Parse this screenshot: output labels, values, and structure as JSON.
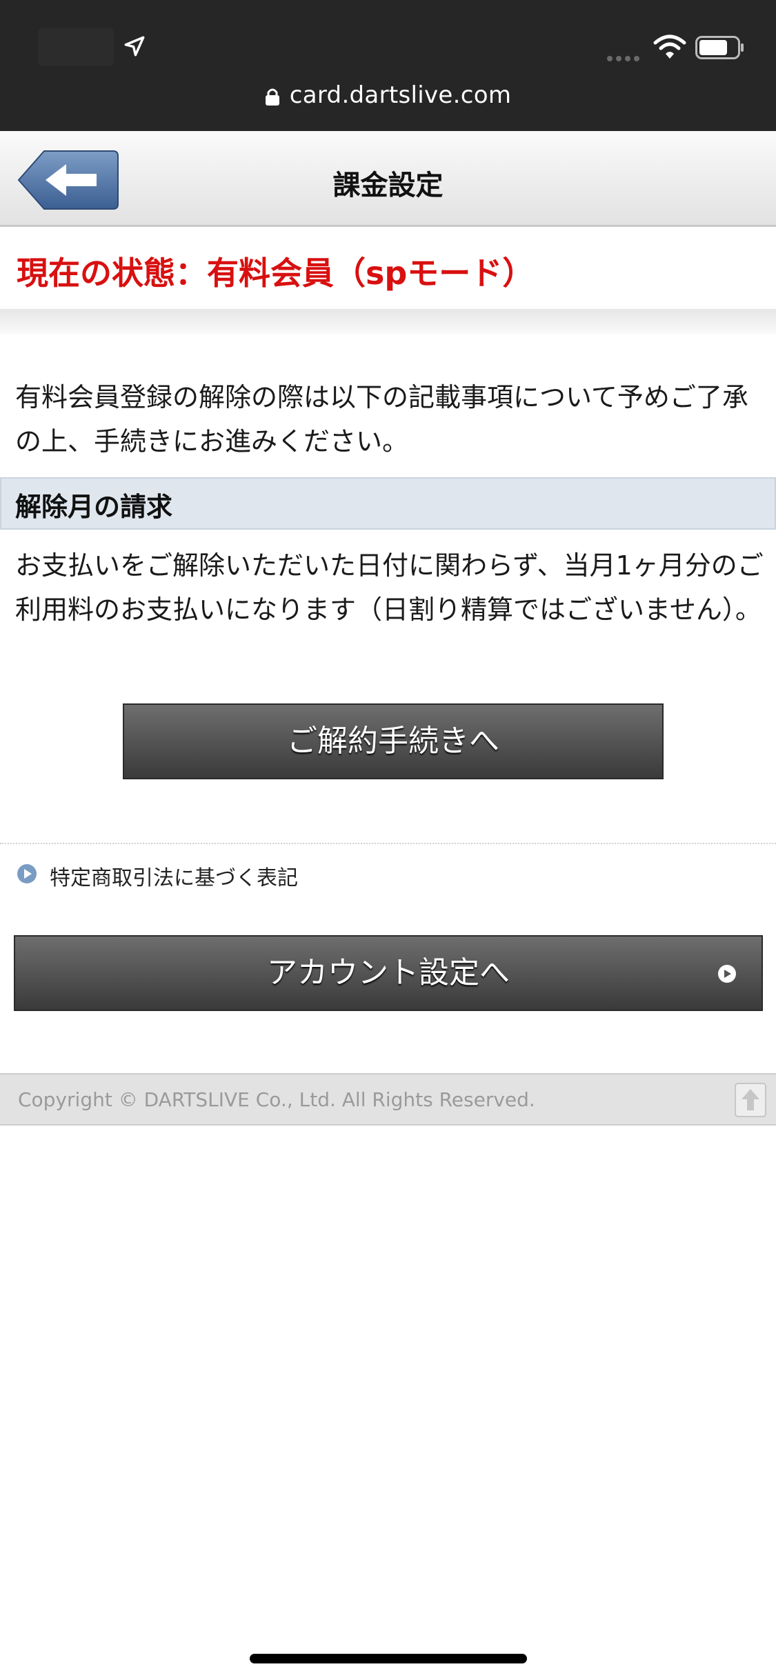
{
  "browser": {
    "url": "card.dartslive.com"
  },
  "header": {
    "title": "課金設定",
    "back_icon": "back-arrow-icon"
  },
  "status": {
    "text": "現在の状態：有料会員（spモード）",
    "color": "#d81010"
  },
  "intro": {
    "text": "有料会員登録の解除の際は以下の記載事項について予めご了承の上、手続きにお進みください。"
  },
  "billing": {
    "heading": "解除月の請求",
    "text": "お支払いをご解除いただいた日付に関わらず、当月1ヶ月分のご利用料のお支払いになります（日割り精算ではございません）。"
  },
  "actions": {
    "cancel_label": "ご解約手続きへ",
    "legal_link": "特定商取引法に基づく表記",
    "account_label": "アカウント設定へ"
  },
  "footer": {
    "copyright": "Copyright © DARTSLIVE Co., Ltd. All Rights Reserved."
  }
}
